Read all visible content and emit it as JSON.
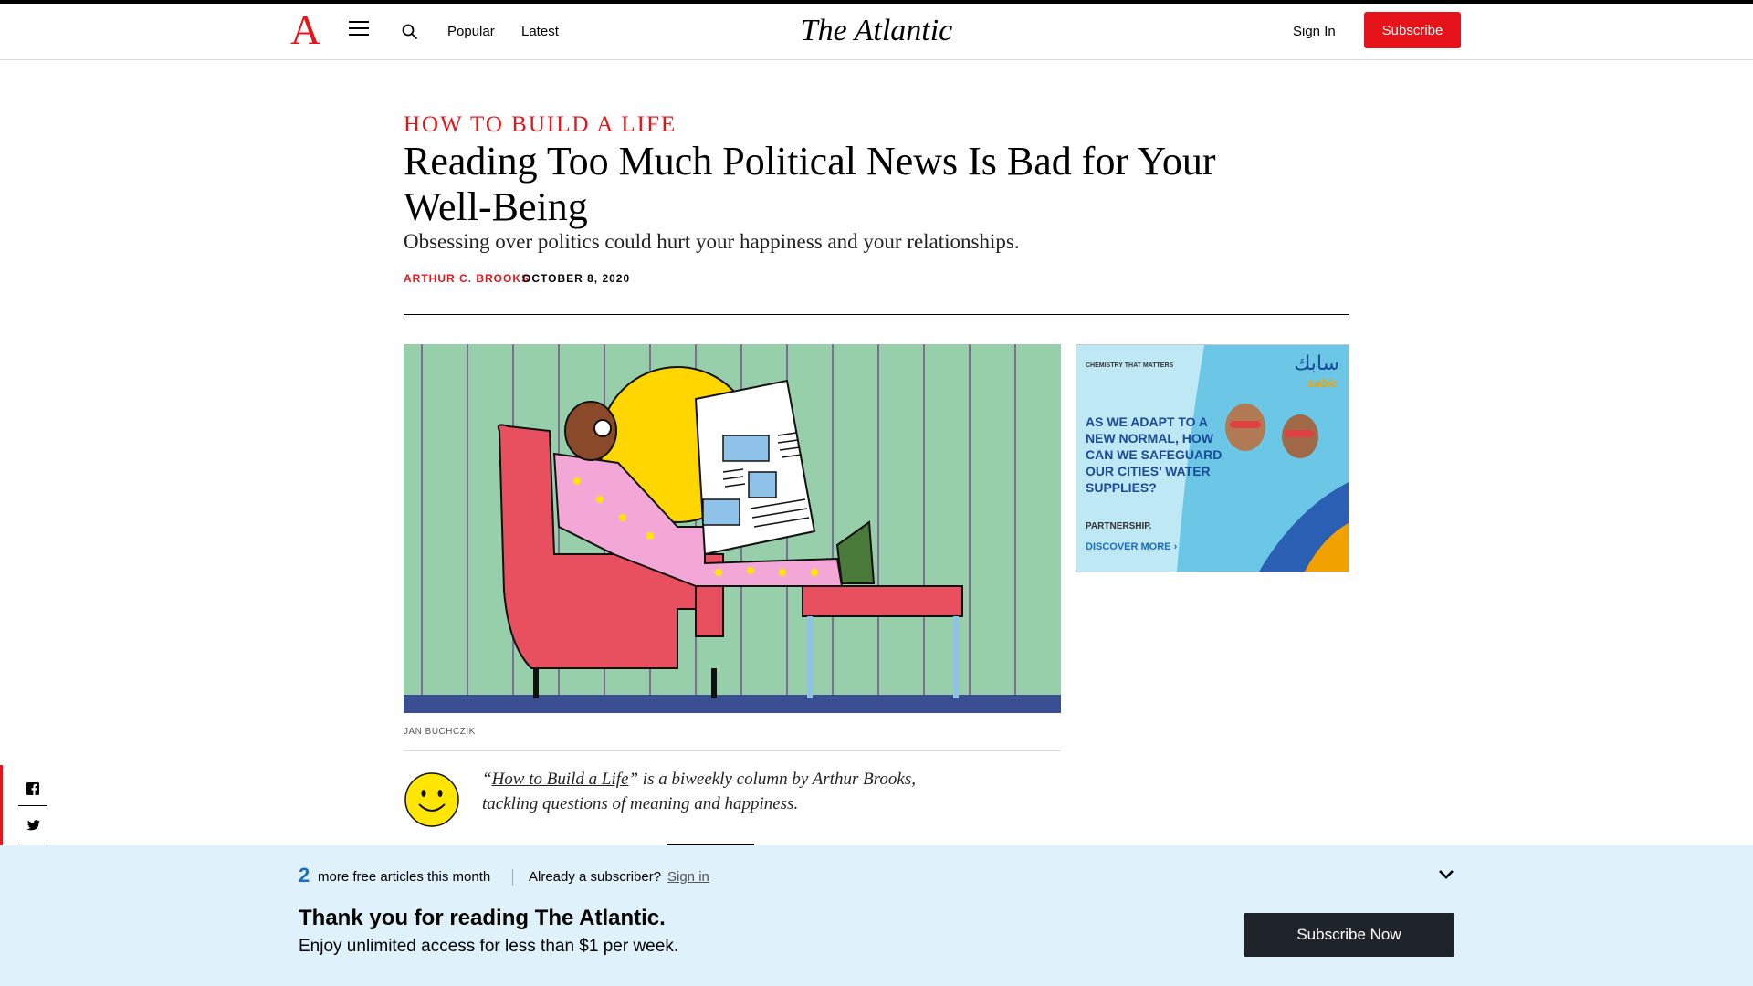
{
  "nav": {
    "logo_letter": "A",
    "popular": "Popular",
    "latest": "Latest",
    "brand": "The Atlantic",
    "sign_in": "Sign In",
    "subscribe": "Subscribe",
    "accent_color": "#e7131a"
  },
  "article": {
    "kicker": "How to Build a Life",
    "headline": "Reading Too Much Political News Is Bad for Your Well-Being",
    "dek": "Obsessing over politics could hurt your happiness and your relationships.",
    "author": "Arthur C. Brooks",
    "date": "October 8, 2020",
    "image_credit": "Jan Buchczik",
    "promo_open_quote": "“",
    "promo_link": "How to Build a Life",
    "promo_rest": "” is a biweekly column by Arthur Brooks, tackling questions of meaning and happiness."
  },
  "ad": {
    "tagline": "Chemistry that matters",
    "brand_arabic": "سابك",
    "brand": "sabic",
    "headline": "As we adapt to a new normal, how can we safeguard our cities’ water supplies?",
    "partnership": "PARTNERSHIP.",
    "cta": "DISCOVER MORE ›"
  },
  "share": {
    "icons": [
      "facebook-icon",
      "twitter-icon"
    ]
  },
  "paywall": {
    "count": "2",
    "free_text": "more free articles this month",
    "already": "Already a subscriber?",
    "sign_in": "Sign in",
    "thanks": "Thank you for reading The Atlantic.",
    "enjoy": "Enjoy unlimited access for less than $1 per week.",
    "subscribe_now": "Subscribe Now",
    "background_color": "#dff1fa"
  }
}
